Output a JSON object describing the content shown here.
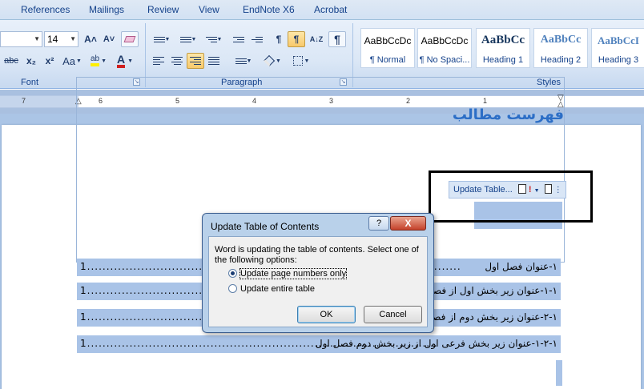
{
  "ribbon": {
    "tabs": [
      "References",
      "Mailings",
      "Review",
      "View",
      "EndNote X6",
      "Acrobat"
    ],
    "font_size": "14",
    "groups": {
      "font": "Font",
      "paragraph": "Paragraph",
      "styles": "Styles"
    },
    "glyphs": {
      "grow": "A˄",
      "shrink": "A˅",
      "strike": "abc",
      "subscript": "x₂",
      "superscript": "x²",
      "change_case": "Aa",
      "highlight": "ab",
      "font_color": "A",
      "ltr": "¶",
      "rtl": "¶",
      "sort": "A↓Z",
      "show_marks": "¶"
    }
  },
  "styles": [
    {
      "sample": "AaBbCcDc",
      "name": "¶ Normal"
    },
    {
      "sample": "AaBbCcDc",
      "name": "¶ No Spaci..."
    },
    {
      "sample": "AaBbCс",
      "name": "Heading 1"
    },
    {
      "sample": "AaBbCc",
      "name": "Heading 2"
    },
    {
      "sample": "AaBbCcI",
      "name": "Heading 3"
    }
  ],
  "ruler": {
    "numbers": [
      "7",
      "6",
      "5",
      "4",
      "3",
      "2",
      "1"
    ]
  },
  "document": {
    "update_table_label": "Update Table...",
    "toc_title": "فهرست مطالب",
    "toc_entries": [
      {
        "title": "١-عنوان فصل اول",
        "page": "1................................................................................................."
      },
      {
        "title": "١-١-عنوان زیر بخش اول از فصل اول",
        "page": "1........................................................"
      },
      {
        "title": "١-٢-عنوان زیر بخش دوم از فصل اول",
        "page": "1........................................................"
      },
      {
        "title": "١-٢-١-عنوان زیر بخش فرعی اول از زیر بخش دوم فصل اول",
        "page": "1..........................................................................................."
      }
    ]
  },
  "dialog": {
    "title": "Update Table of Contents",
    "help": "?",
    "close": "X",
    "message": "Word is updating the table of contents.  Select one of the following options:",
    "options": [
      {
        "label": "Update page numbers only",
        "selected": true
      },
      {
        "label": "Update entire table",
        "selected": false
      }
    ],
    "ok_label": "OK",
    "cancel_label": "Cancel"
  },
  "colors": {
    "accent": "#15428b",
    "selection": "#a9c3e7",
    "heading": "#2c6ec6"
  }
}
